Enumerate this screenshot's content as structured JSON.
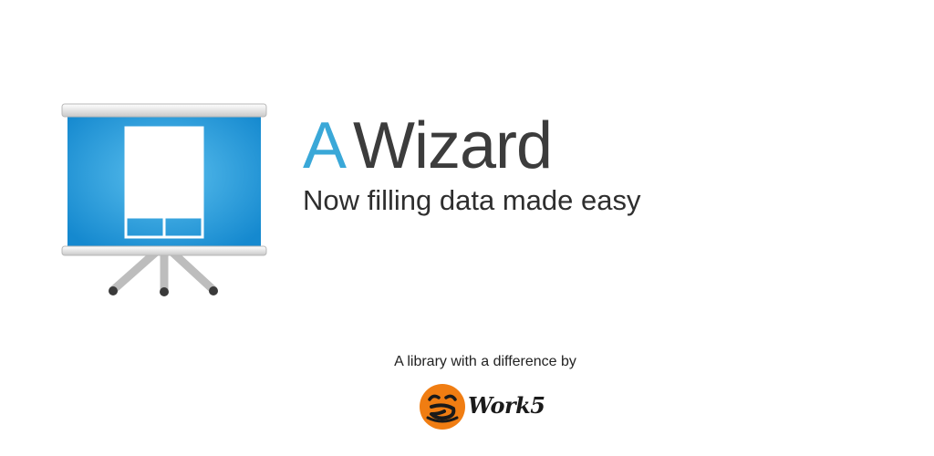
{
  "header": {
    "title_accent": "A",
    "title_main": "Wizard",
    "subtitle": "Now filling data made easy"
  },
  "footer": {
    "credit": "A library with a difference by",
    "logo_text": "Work5"
  },
  "icons": {
    "app": "presentation-easel-icon",
    "logo": "bworks-logo-icon"
  },
  "colors": {
    "accent": "#3aa8d8",
    "screen_blue": "#1e9fe0",
    "logo_orange": "#f07d12",
    "text_dark": "#3c3c3c"
  }
}
